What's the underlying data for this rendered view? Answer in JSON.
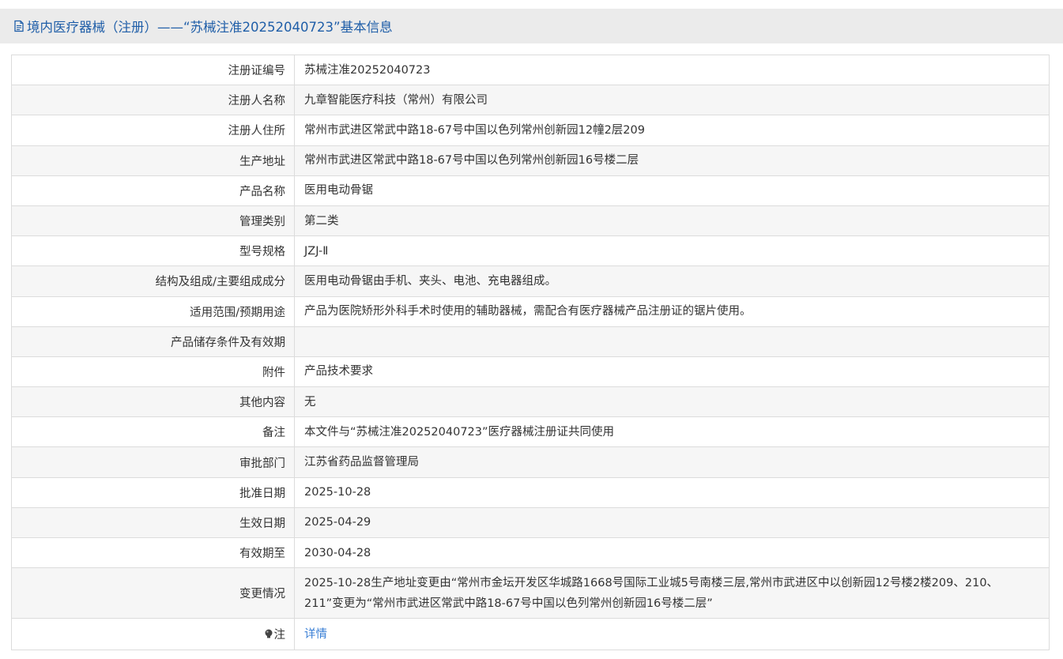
{
  "header": {
    "title": "境内医疗器械（注册）——“苏械注准20252040723”基本信息",
    "icon": "document-icon",
    "color": "#1f5ea8"
  },
  "rows": [
    {
      "label": "注册证编号",
      "value": "苏械注准20252040723"
    },
    {
      "label": "注册人名称",
      "value": "九章智能医疗科技（常州）有限公司"
    },
    {
      "label": "注册人住所",
      "value": "常州市武进区常武中路18-67号中国以色列常州创新园12幢2层209"
    },
    {
      "label": "生产地址",
      "value": "常州市武进区常武中路18-67号中国以色列常州创新园16号楼二层"
    },
    {
      "label": "产品名称",
      "value": "医用电动骨锯"
    },
    {
      "label": "管理类别",
      "value": "第二类"
    },
    {
      "label": "型号规格",
      "value": "JZJ-Ⅱ"
    },
    {
      "label": "结构及组成/主要组成成分",
      "value": "医用电动骨锯由手机、夹头、电池、充电器组成。"
    },
    {
      "label": "适用范围/预期用途",
      "value": "产品为医院矫形外科手术时使用的辅助器械，需配合有医疗器械产品注册证的锯片使用。"
    },
    {
      "label": "产品储存条件及有效期",
      "value": ""
    },
    {
      "label": "附件",
      "value": "产品技术要求"
    },
    {
      "label": "其他内容",
      "value": "无"
    },
    {
      "label": "备注",
      "value": "本文件与“苏械注准20252040723”医疗器械注册证共同使用"
    },
    {
      "label": "审批部门",
      "value": "江苏省药品监督管理局"
    },
    {
      "label": "批准日期",
      "value": "2025-10-28"
    },
    {
      "label": "生效日期",
      "value": "2025-04-29"
    },
    {
      "label": "有效期至",
      "value": "2030-04-28"
    },
    {
      "label": "变更情况",
      "value": "2025-10-28生产地址变更由“常州市金坛开发区华城路1668号国际工业城5号南楼三层,常州市武进区中以创新园12号楼2楼209、210、211”变更为“常州市武进区常武中路18-67号中国以色列常州创新园16号楼二层”"
    }
  ],
  "note_row": {
    "label": "注",
    "icon": "lightbulb-icon",
    "link_text": "详情",
    "link_color": "#3a7fd5"
  }
}
